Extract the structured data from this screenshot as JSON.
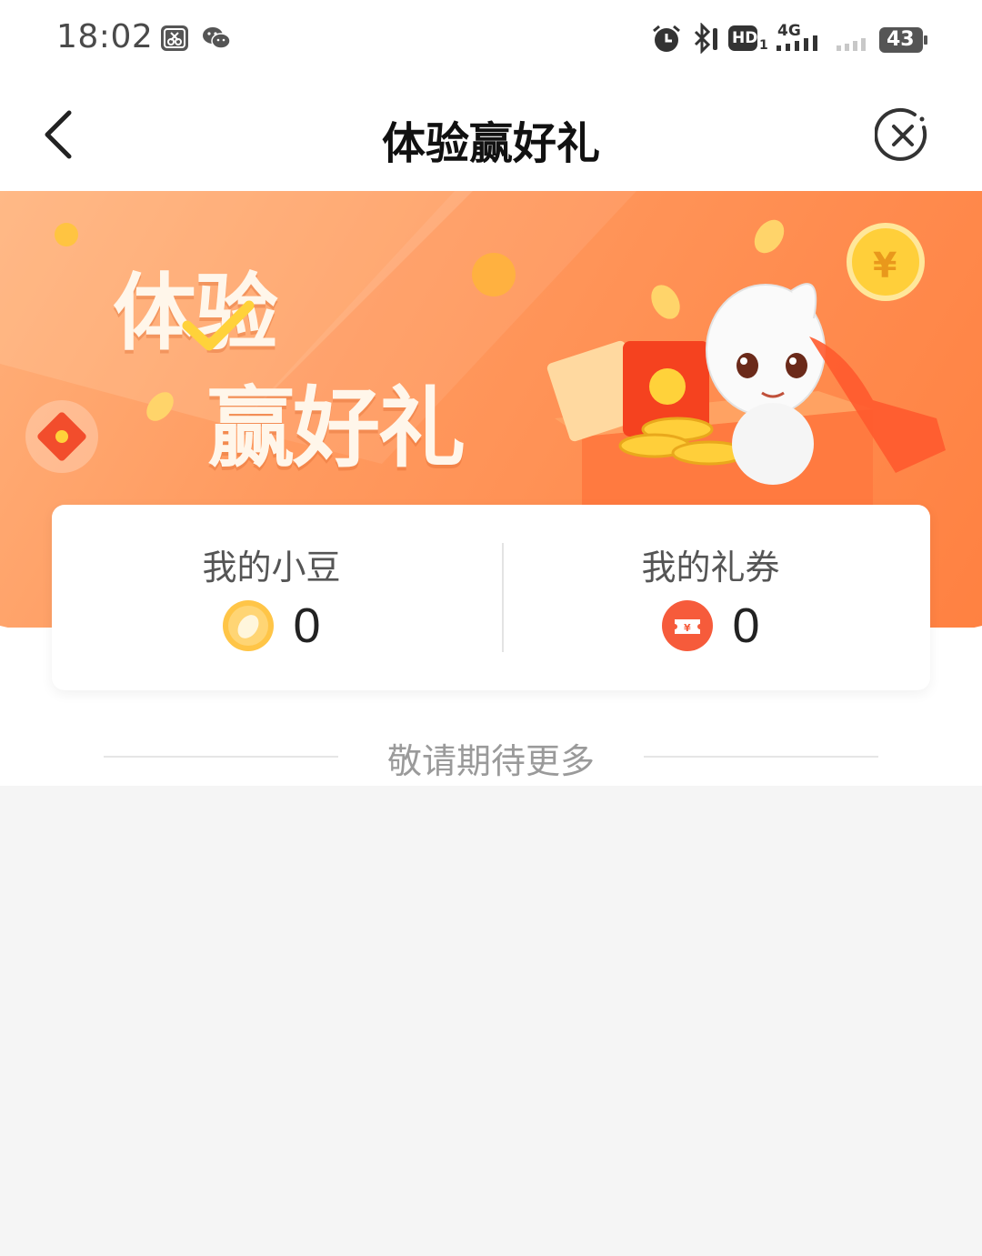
{
  "status_bar": {
    "time": "18:02",
    "network_label": "4G",
    "hd_label": "HD",
    "sim_index": "1",
    "battery": "43",
    "icons": [
      "screenshot-app-icon",
      "wechat-icon",
      "alarm-icon",
      "bluetooth-icon",
      "hd-icon",
      "signal-icon",
      "battery-icon"
    ]
  },
  "nav": {
    "title": "体验赢好礼",
    "back_icon": "chevron-left-icon",
    "close_icon": "close-circle-icon"
  },
  "banner": {
    "headline_line1": "体验",
    "headline_line2": "赢好礼",
    "colors": {
      "start": "#ffb07a",
      "end": "#ff8040",
      "text": "#fff6ea",
      "accent": "#ffd23a"
    }
  },
  "stats": {
    "beans_label": "我的小豆",
    "beans_value": "0",
    "beans_icon": "bean-coin-icon",
    "coupons_label": "我的礼券",
    "coupons_value": "0",
    "coupons_icon": "coupon-icon"
  },
  "footer_divider": {
    "text": "敬请期待更多"
  }
}
